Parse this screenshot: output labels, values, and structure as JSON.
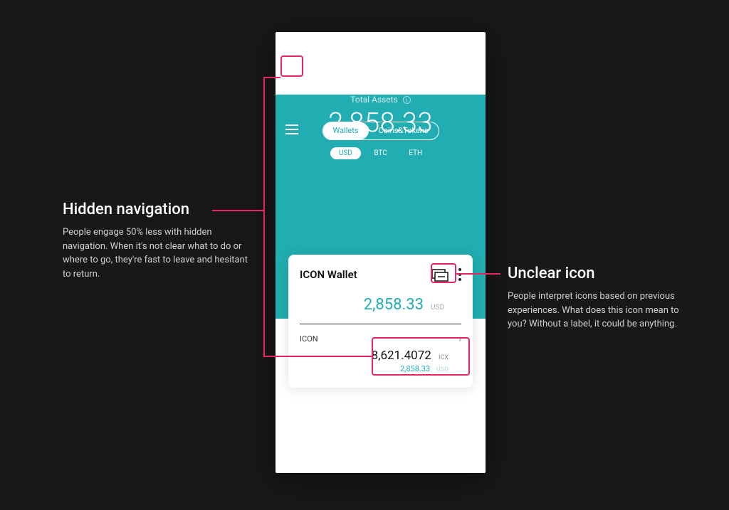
{
  "phone": {
    "tabs": {
      "wallets": "Wallets",
      "coins": "Coins&Tokens"
    },
    "total_label": "Total Assets",
    "total_value": "2,858.33",
    "currencies": {
      "usd": "USD",
      "btc": "BTC",
      "eth": "ETH"
    },
    "wallet_pill": "ICON Wallet",
    "card": {
      "title": "ICON Wallet",
      "balance": "2,858.33",
      "balance_sym": "USD",
      "coin": {
        "name": "ICON",
        "amount": "8,621.4072",
        "amount_sym": "ICX",
        "fiat": "2,858.33",
        "fiat_sym": "USD"
      }
    }
  },
  "annotations": {
    "left": {
      "title": "Hidden navigation",
      "body": "People engage 50% less with hidden navigation. When it's not clear what to do or where to go, they're fast to leave and hesitant to return."
    },
    "right": {
      "title": "Unclear icon",
      "body": "People interpret icons based on previous experiences. What does this icon mean to you? Without a label, it could be anything."
    }
  },
  "colors": {
    "accent": "#E6265F",
    "teal": "#21ADB1"
  }
}
